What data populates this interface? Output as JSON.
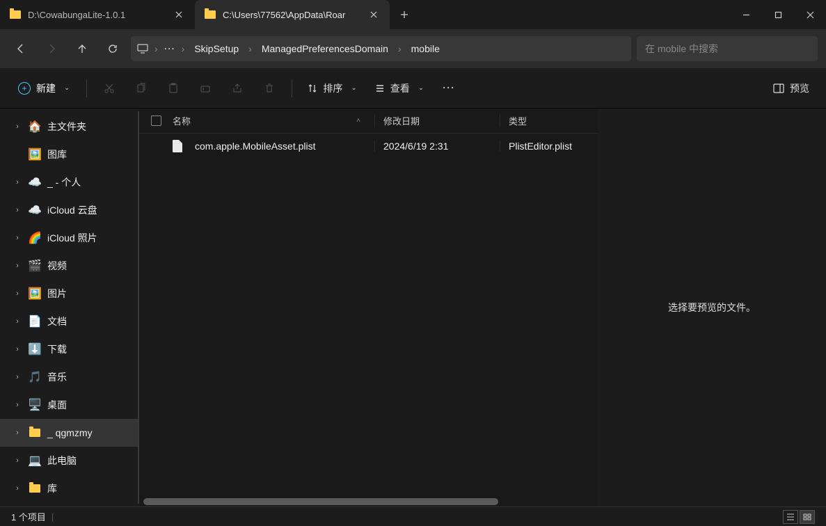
{
  "tabs": [
    {
      "title": "D:\\CowabungaLite-1.0.1",
      "active": false
    },
    {
      "title": "C:\\Users\\77562\\AppData\\Roar",
      "active": true
    }
  ],
  "breadcrumb": {
    "segments": [
      "SkipSetup",
      "ManagedPreferencesDomain",
      "mobile"
    ]
  },
  "search": {
    "placeholder": "在 mobile 中搜索"
  },
  "toolbar": {
    "new_label": "新建",
    "sort_label": "排序",
    "view_label": "查看",
    "preview_label": "预览"
  },
  "sidebar": {
    "items": [
      {
        "label": "主文件夹",
        "icon": "home",
        "exp": "closed"
      },
      {
        "label": "图库",
        "icon": "gallery",
        "exp": "none"
      },
      {
        "label": "_ - 个人",
        "icon": "onedrive",
        "exp": "closed"
      },
      {
        "label": "iCloud 云盘",
        "icon": "icloud",
        "exp": "closed"
      },
      {
        "label": "iCloud 照片",
        "icon": "icloud-photos",
        "exp": "closed"
      },
      {
        "label": "视频",
        "icon": "video",
        "exp": "closed"
      },
      {
        "label": "图片",
        "icon": "pictures",
        "exp": "closed"
      },
      {
        "label": "文档",
        "icon": "docs",
        "exp": "closed"
      },
      {
        "label": "下载",
        "icon": "downloads",
        "exp": "closed"
      },
      {
        "label": "音乐",
        "icon": "music",
        "exp": "closed"
      },
      {
        "label": "桌面",
        "icon": "desktop",
        "exp": "closed"
      },
      {
        "label": "_ qgmzmy",
        "icon": "folder",
        "exp": "closed",
        "selected": true
      },
      {
        "label": "此电脑",
        "icon": "pc",
        "exp": "closed"
      },
      {
        "label": "库",
        "icon": "folder",
        "exp": "closed"
      }
    ]
  },
  "columns": {
    "name": "名称",
    "date": "修改日期",
    "type": "类型"
  },
  "files": [
    {
      "name": "com.apple.MobileAsset.plist",
      "date": "2024/6/19 2:31",
      "type": "PlistEditor.plist"
    }
  ],
  "preview": {
    "empty_text": "选择要预览的文件。"
  },
  "status": {
    "count_text": "1 个项目"
  }
}
